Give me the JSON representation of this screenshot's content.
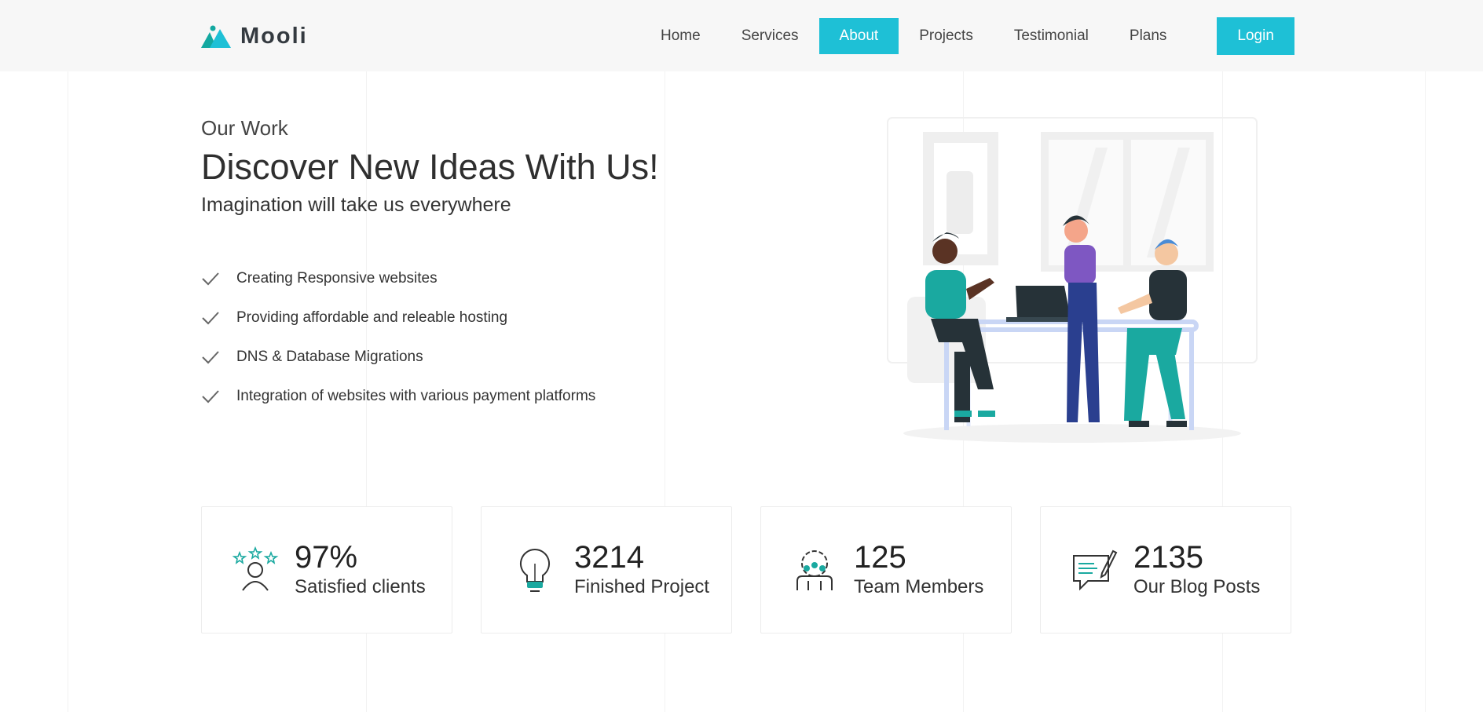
{
  "brand": {
    "name": "Mooli",
    "logo_icon": "mountain-logo-icon",
    "accent": "#1ec0d6",
    "logo_color": "#13a8a0"
  },
  "nav": {
    "items": [
      {
        "label": "Home",
        "active": false
      },
      {
        "label": "Services",
        "active": false
      },
      {
        "label": "About",
        "active": true
      },
      {
        "label": "Projects",
        "active": false
      },
      {
        "label": "Testimonial",
        "active": false
      },
      {
        "label": "Plans",
        "active": false
      }
    ],
    "login_label": "Login"
  },
  "hero": {
    "eyebrow": "Our Work",
    "headline": "Discover New Ideas With Us!",
    "subhead": "Imagination will take us everywhere",
    "features": [
      "Creating Responsive websites",
      "Providing affordable and releable hosting",
      "DNS & Database Migrations",
      "Integration of websites with various payment platforms"
    ],
    "feature_icon": "checkmark-icon",
    "illustration": "team-working-at-desk-illustration"
  },
  "stats": [
    {
      "value": "97%",
      "label": "Satisfied clients",
      "icon": "satisfied-client-icon"
    },
    {
      "value": "3214",
      "label": "Finished Project",
      "icon": "lightbulb-icon"
    },
    {
      "value": "125",
      "label": "Team Members",
      "icon": "team-gear-icon"
    },
    {
      "value": "2135",
      "label": "Our Blog Posts",
      "icon": "blog-post-icon"
    }
  ]
}
